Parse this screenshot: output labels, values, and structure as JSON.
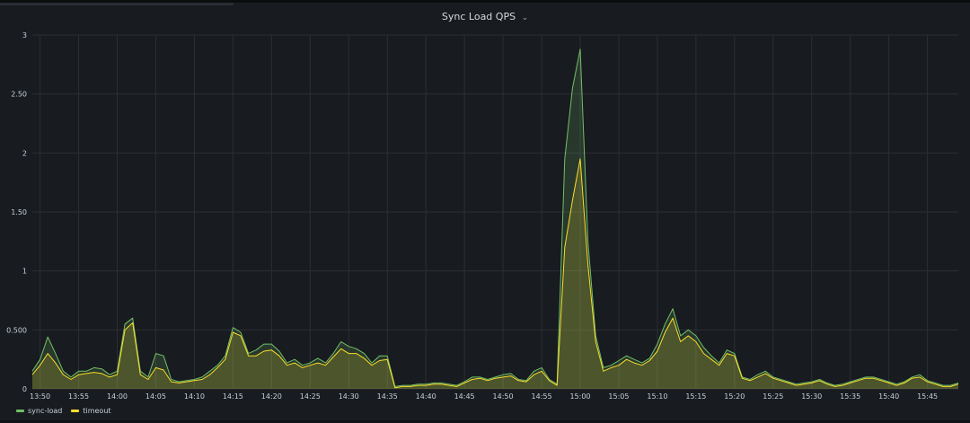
{
  "panel": {
    "title": "Sync Load QPS"
  },
  "icons": {
    "title_menu": "chevron-down-icon"
  },
  "chart_data": {
    "type": "area",
    "x_ticks": [
      "13:50",
      "13:55",
      "14:00",
      "14:05",
      "14:10",
      "14:15",
      "14:20",
      "14:25",
      "14:30",
      "14:35",
      "14:40",
      "14:45",
      "14:50",
      "14:55",
      "15:00",
      "15:05",
      "15:10",
      "15:15",
      "15:20",
      "15:25",
      "15:30",
      "15:35",
      "15:40",
      "15:45"
    ],
    "y_ticks": [
      "0",
      "0.500",
      "1",
      "1.50",
      "2",
      "2.50",
      "3"
    ],
    "ylim": [
      0,
      3
    ],
    "xlim": [
      "13:49",
      "15:49"
    ],
    "grid": true,
    "legend_position": "bottom-left",
    "x": [
      "13:49",
      "13:50",
      "13:51",
      "13:52",
      "13:53",
      "13:54",
      "13:55",
      "13:56",
      "13:57",
      "13:58",
      "13:59",
      "14:00",
      "14:01",
      "14:02",
      "14:03",
      "14:04",
      "14:05",
      "14:06",
      "14:07",
      "14:08",
      "14:09",
      "14:10",
      "14:11",
      "14:12",
      "14:13",
      "14:14",
      "14:15",
      "14:16",
      "14:17",
      "14:18",
      "14:19",
      "14:20",
      "14:21",
      "14:22",
      "14:23",
      "14:24",
      "14:25",
      "14:26",
      "14:27",
      "14:28",
      "14:29",
      "14:30",
      "14:31",
      "14:32",
      "14:33",
      "14:34",
      "14:35",
      "14:36",
      "14:37",
      "14:38",
      "14:39",
      "14:40",
      "14:41",
      "14:42",
      "14:43",
      "14:44",
      "14:45",
      "14:46",
      "14:47",
      "14:48",
      "14:49",
      "14:50",
      "14:51",
      "14:52",
      "14:53",
      "14:54",
      "14:55",
      "14:56",
      "14:57",
      "14:58",
      "14:59",
      "15:00",
      "15:01",
      "15:02",
      "15:03",
      "15:04",
      "15:05",
      "15:06",
      "15:07",
      "15:08",
      "15:09",
      "15:10",
      "15:11",
      "15:12",
      "15:13",
      "15:14",
      "15:15",
      "15:16",
      "15:17",
      "15:18",
      "15:19",
      "15:20",
      "15:21",
      "15:22",
      "15:23",
      "15:24",
      "15:25",
      "15:26",
      "15:27",
      "15:28",
      "15:29",
      "15:30",
      "15:31",
      "15:32",
      "15:33",
      "15:34",
      "15:35",
      "15:36",
      "15:37",
      "15:38",
      "15:39",
      "15:40",
      "15:41",
      "15:42",
      "15:43",
      "15:44",
      "15:45",
      "15:46",
      "15:47",
      "15:48",
      "15:49"
    ],
    "series": [
      {
        "name": "sync-load",
        "color": "#73bf69",
        "values": [
          0.15,
          0.25,
          0.44,
          0.3,
          0.15,
          0.1,
          0.15,
          0.15,
          0.18,
          0.17,
          0.12,
          0.15,
          0.55,
          0.6,
          0.15,
          0.1,
          0.3,
          0.28,
          0.08,
          0.06,
          0.07,
          0.08,
          0.1,
          0.15,
          0.2,
          0.28,
          0.52,
          0.48,
          0.3,
          0.33,
          0.38,
          0.38,
          0.32,
          0.22,
          0.25,
          0.2,
          0.22,
          0.26,
          0.22,
          0.3,
          0.4,
          0.36,
          0.34,
          0.3,
          0.22,
          0.28,
          0.28,
          0.02,
          0.03,
          0.03,
          0.04,
          0.04,
          0.05,
          0.05,
          0.04,
          0.03,
          0.06,
          0.1,
          0.1,
          0.08,
          0.1,
          0.12,
          0.13,
          0.08,
          0.07,
          0.15,
          0.18,
          0.08,
          0.04,
          1.95,
          2.55,
          2.88,
          1.25,
          0.45,
          0.18,
          0.2,
          0.24,
          0.28,
          0.25,
          0.22,
          0.26,
          0.38,
          0.55,
          0.68,
          0.45,
          0.5,
          0.45,
          0.35,
          0.28,
          0.22,
          0.33,
          0.3,
          0.1,
          0.08,
          0.12,
          0.15,
          0.1,
          0.08,
          0.06,
          0.04,
          0.05,
          0.06,
          0.08,
          0.05,
          0.03,
          0.04,
          0.06,
          0.08,
          0.1,
          0.1,
          0.08,
          0.06,
          0.04,
          0.06,
          0.1,
          0.12,
          0.07,
          0.05,
          0.03,
          0.03,
          0.05
        ]
      },
      {
        "name": "timeout",
        "color": "#fade2a",
        "values": [
          0.12,
          0.2,
          0.3,
          0.22,
          0.12,
          0.08,
          0.12,
          0.13,
          0.14,
          0.13,
          0.1,
          0.12,
          0.5,
          0.56,
          0.12,
          0.08,
          0.18,
          0.16,
          0.06,
          0.05,
          0.06,
          0.07,
          0.08,
          0.12,
          0.18,
          0.25,
          0.48,
          0.45,
          0.28,
          0.28,
          0.32,
          0.33,
          0.28,
          0.2,
          0.22,
          0.18,
          0.2,
          0.22,
          0.2,
          0.27,
          0.34,
          0.3,
          0.3,
          0.26,
          0.2,
          0.24,
          0.25,
          0.01,
          0.02,
          0.02,
          0.03,
          0.03,
          0.04,
          0.04,
          0.03,
          0.02,
          0.05,
          0.08,
          0.09,
          0.07,
          0.09,
          0.1,
          0.11,
          0.07,
          0.06,
          0.12,
          0.15,
          0.07,
          0.03,
          1.2,
          1.6,
          1.95,
          1.05,
          0.4,
          0.15,
          0.18,
          0.2,
          0.25,
          0.22,
          0.2,
          0.24,
          0.32,
          0.48,
          0.6,
          0.4,
          0.45,
          0.4,
          0.3,
          0.25,
          0.2,
          0.3,
          0.28,
          0.09,
          0.07,
          0.1,
          0.13,
          0.09,
          0.07,
          0.05,
          0.03,
          0.04,
          0.05,
          0.07,
          0.04,
          0.02,
          0.03,
          0.05,
          0.07,
          0.09,
          0.09,
          0.07,
          0.05,
          0.03,
          0.05,
          0.09,
          0.1,
          0.06,
          0.04,
          0.02,
          0.02,
          0.04
        ]
      }
    ]
  }
}
